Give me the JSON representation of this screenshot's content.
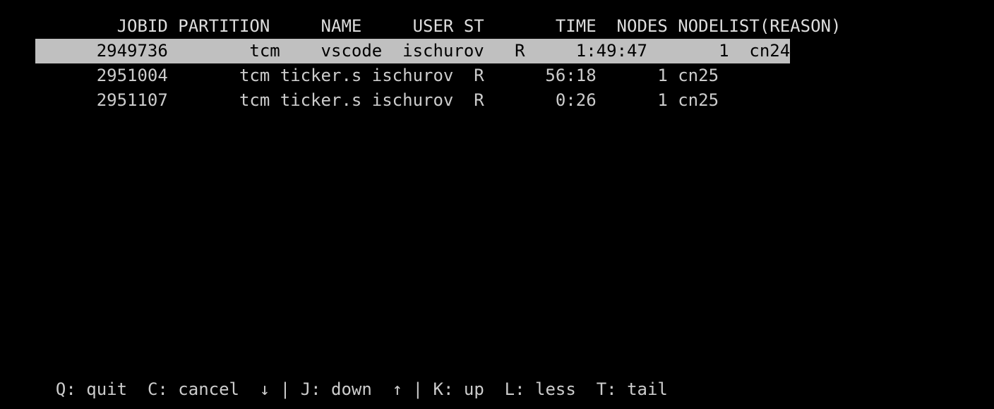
{
  "headers": {
    "jobid": "JOBID",
    "partition": "PARTITION",
    "name": "NAME",
    "user": "USER",
    "st": "ST",
    "time": "TIME",
    "nodes": "NODES",
    "nodelist": "NODELIST(REASON)"
  },
  "rows": [
    {
      "jobid": "2949736",
      "partition": "tcm",
      "name": "vscode",
      "user": "ischurov",
      "st": "R",
      "time": "1:49:47",
      "nodes": "1",
      "nodelist": "cn24",
      "selected": true
    },
    {
      "jobid": "2951004",
      "partition": "tcm",
      "name": "ticker.s",
      "user": "ischurov",
      "st": "R",
      "time": "56:18",
      "nodes": "1",
      "nodelist": "cn25",
      "selected": false
    },
    {
      "jobid": "2951107",
      "partition": "tcm",
      "name": "ticker.s",
      "user": "ischurov",
      "st": "R",
      "time": "0:26",
      "nodes": "1",
      "nodelist": "cn25",
      "selected": false
    }
  ],
  "footer": {
    "quit": "Q: quit",
    "cancel": "C: cancel",
    "down": "↓ | J: down",
    "up": "↑ | K: up",
    "less": "L: less",
    "tail": "T: tail"
  }
}
